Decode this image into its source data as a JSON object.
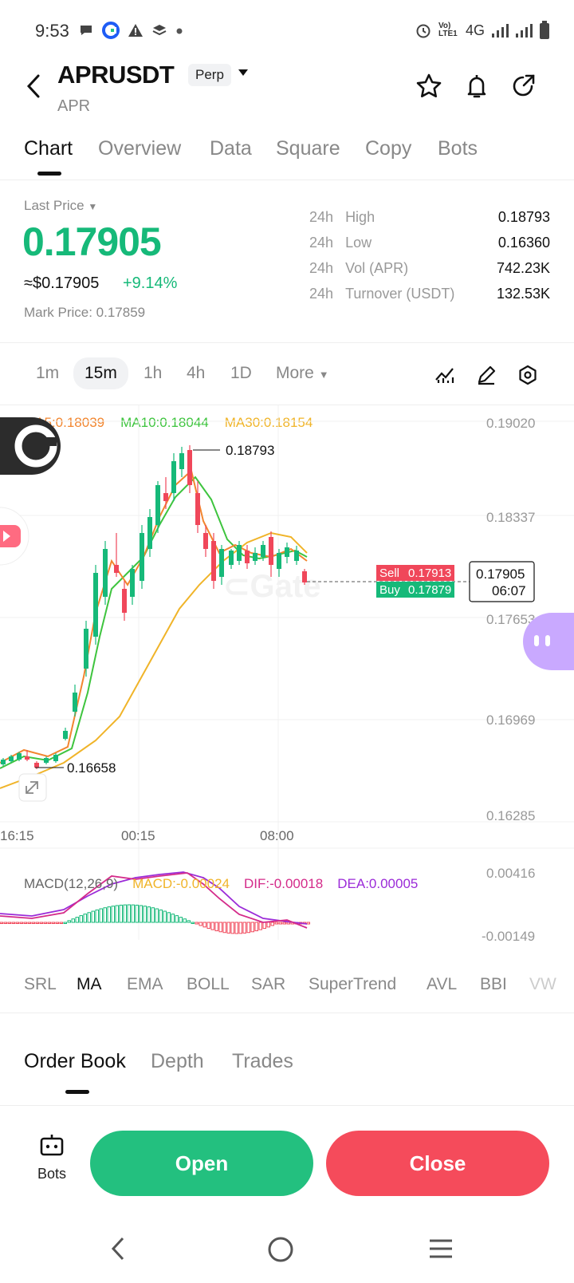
{
  "status_bar": {
    "time": "9:53",
    "network": "4G",
    "volte": "Vo) LTE1"
  },
  "header": {
    "pair": "APRUSDT",
    "badge": "Perp",
    "sub": "APR"
  },
  "tabs": [
    "Chart",
    "Overview",
    "Data",
    "Square",
    "Copy",
    "Bots"
  ],
  "price": {
    "last_label": "Last Price",
    "last": "0.17905",
    "usd": "≈$0.17905",
    "change": "+9.14%",
    "mark": "Mark Price: 0.17859",
    "stats": [
      {
        "period": "24h",
        "label": "High",
        "value": "0.18793"
      },
      {
        "period": "24h",
        "label": "Low",
        "value": "0.16360"
      },
      {
        "period": "24h",
        "label": "Vol (APR)",
        "value": "742.23K"
      },
      {
        "period": "24h",
        "label": "Turnover (USDT)",
        "value": "132.53K"
      }
    ]
  },
  "intervals": [
    "1m",
    "15m",
    "1h",
    "4h",
    "1D",
    "More"
  ],
  "chart": {
    "ma5": "MA5:0.18039",
    "ma10": "MA10:0.18044",
    "ma30": "MA30:0.18154",
    "y_ticks": [
      "0.19020",
      "0.18337",
      "0.17653",
      "0.16969",
      "0.16285"
    ],
    "x_ticks": [
      "16:15",
      "00:15",
      "08:00"
    ],
    "high_marker": "0.18793",
    "low_marker": "0.16658",
    "sell_label": "Sell",
    "sell_value": "0.17913",
    "buy_label": "Buy",
    "buy_value": "0.17879",
    "current_price": "0.17905",
    "countdown": "06:07",
    "macd_title": "MACD(12,26,9)",
    "macd_value": "MACD:-0.00024",
    "dif": "DIF:-0.00018",
    "dea": "DEA:0.00005",
    "macd_top": "0.00416",
    "macd_bottom": "-0.00149",
    "colors": {
      "up": "#16b979",
      "down": "#f0475a",
      "ma5": "#f2862f",
      "ma10": "#3ec43e",
      "ma30": "#f0b429",
      "dif": "#d42b8a",
      "dea": "#9b2bd8"
    }
  },
  "indicators": [
    "SRL",
    "MA",
    "EMA",
    "BOLL",
    "SAR",
    "SuperTrend",
    "AVL",
    "BBI",
    "VW"
  ],
  "orderbook_tabs": [
    "Order Book",
    "Depth",
    "Trades"
  ],
  "actions": {
    "bots": "Bots",
    "open": "Open",
    "close": "Close"
  },
  "icons": [
    "back-icon",
    "caret-down-icon",
    "star-icon",
    "bell-icon",
    "share-icon",
    "indicator-icon",
    "pencil-icon",
    "settings-icon",
    "expand-icon",
    "bot-icon",
    "nav-back-icon",
    "nav-home-icon",
    "nav-menu-icon"
  ]
}
